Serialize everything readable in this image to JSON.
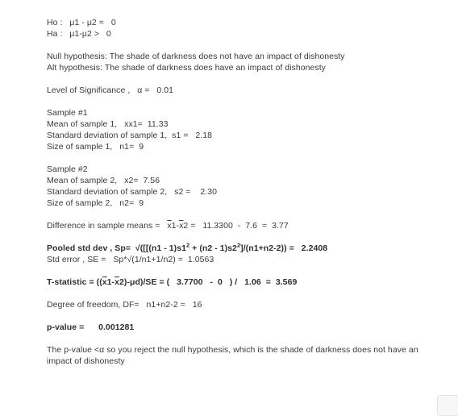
{
  "document": {
    "hypotheses": {
      "null_symbolic": "Ho :   μ1 - μ2 =   0",
      "alt_symbolic": "Ha :   μ1-μ2 >   0",
      "null_text": "Null hypothesis: The shade of darkness does not have an impact of dishonesty",
      "alt_text": "Alt hypothesis: The shade of darkness does have an impact of dishonesty"
    },
    "significance": {
      "label": "Level of Significance ,",
      "symbol": "α =",
      "value": "0.01"
    },
    "sample1": {
      "heading": "Sample #1",
      "mean_label": "Mean of sample 1,",
      "mean_symbol": "xx1=",
      "mean_value": "11.33",
      "sd_label": "Standard deviation of sample 1,",
      "sd_symbol": "s1 =",
      "sd_value": "2.18",
      "size_label": "Size of sample 1,",
      "size_symbol": "n1=",
      "size_value": "9"
    },
    "sample2": {
      "heading": "Sample #2",
      "mean_label": "Mean of sample 2,",
      "mean_symbol": "x2=",
      "mean_value": "7.56",
      "sd_label": "Standard deviation of sample 2,",
      "sd_symbol": "s2 =",
      "sd_value": "2.30",
      "size_label": "Size of sample 2,",
      "size_symbol": "n2=",
      "size_value": "9"
    },
    "difference": {
      "label": "Difference in sample means =",
      "symbol_x1": "x",
      "symbol_x1_sub": "1-",
      "symbol_x2": "x",
      "symbol_x2_sub": "2 =",
      "operand1": "11.3300",
      "operator": "-",
      "operand2": "7.6",
      "equals": "=",
      "result": "3.77"
    },
    "pooled": {
      "label": "Pooled std dev , Sp=",
      "formula_pre": "√([[(n1 - 1)s1",
      "formula_mid": " + (n2 - 1)s2",
      "formula_post": "]/(n1+n2-2)) =",
      "sup": "2",
      "value": "2.2408"
    },
    "std_error": {
      "label": "Std error , SE =",
      "formula": "Sp*√(1/n1+1/n2) =",
      "value": "1.0563"
    },
    "t_statistic": {
      "label_pre": "T-statistic = ((",
      "x1": "x",
      "x1_sub": "1-",
      "x2": "x",
      "x2_sub": "2)-μd)/SE = (",
      "numerator1": "3.7700",
      "operator": "-",
      "numerator2": "0",
      "close": ") /",
      "denominator": "1.06",
      "equals": "=",
      "result": "3.569"
    },
    "degrees_freedom": {
      "label": "Degree of freedom, DF=",
      "formula": "n1+n2-2 =",
      "value": "16"
    },
    "p_value": {
      "label": "p-value =",
      "value": "0.001281"
    },
    "conclusion": "The p-value <α so you reject the null hypothesis, which is the shade of darkness does not have an impact of dishonesty"
  }
}
